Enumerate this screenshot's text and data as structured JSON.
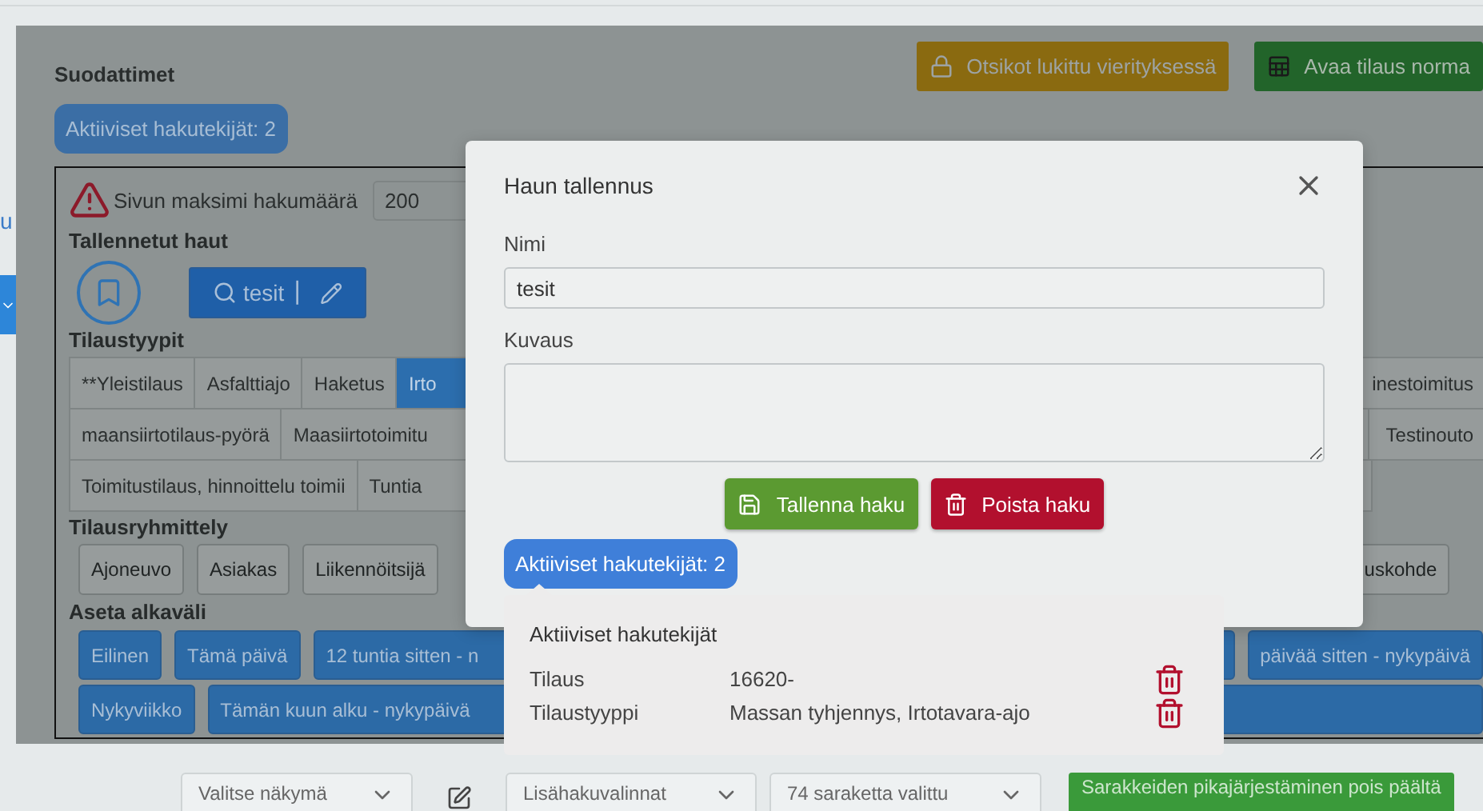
{
  "page": {
    "left_link": "u"
  },
  "header_buttons": [
    {
      "label": "Otsikot lukittu vierityksessä",
      "kind": "lock"
    },
    {
      "label": "Avaa tilaus norma",
      "kind": "table"
    }
  ],
  "filters": {
    "title": "Suodattimet",
    "active_badge": "Aktiiviset hakutekijät: 2",
    "max_label": "Sivun maksimi hakumäärä",
    "max_value": "200",
    "saved_title": "Tallennetut haut",
    "saved_search": "tesit",
    "saved_separator": "|",
    "order_types_title": "Tilaustyypit",
    "order_type_rows": [
      {
        "left": [
          {
            "label": "**Yleistilaus",
            "selected": false
          },
          {
            "label": "Asfalttiajo",
            "selected": false
          },
          {
            "label": "Haketus",
            "selected": false
          },
          {
            "label": "Irto",
            "selected": true
          }
        ],
        "right": [
          {
            "label": "inestoimitus",
            "selected": false
          }
        ]
      },
      {
        "left": [
          {
            "label": "maansiirtotilaus-pyörä",
            "selected": false
          },
          {
            "label": "Maasiirtotoimitu",
            "selected": false
          }
        ],
        "right": [
          {
            "label": "Testinouto",
            "selected": false
          }
        ]
      },
      {
        "left": [
          {
            "label": "Toimitustilaus, hinnoittelu toimii",
            "selected": false
          },
          {
            "label": "Tuntia",
            "selected": false
          }
        ],
        "right": []
      }
    ],
    "grouping_title": "Tilausryhmittely",
    "grouping": {
      "left": [
        "Ajoneuvo",
        "Asiakas",
        "Liikennöitsijä"
      ],
      "right": [
        "uskohde"
      ]
    },
    "range_title": "Aseta alkaväli",
    "range_rows": [
      {
        "left": [
          "Eilinen",
          "Tämä päivä",
          "12 tuntia sitten - n"
        ],
        "right": [
          "päivää sitten - nykypäivä"
        ]
      },
      {
        "left": [
          "Nykyviikko",
          "Tämän kuun alku - nykypäivä"
        ],
        "right": []
      }
    ]
  },
  "bottom_bar": {
    "view_select": "Valitse näkymä",
    "extra_select": "Lisähakuvalinnat",
    "columns_select": "74 saraketta valittu",
    "sort_button": "Sarakkeiden pikajärjestäminen pois päältä"
  },
  "modal": {
    "title": "Haun tallennus",
    "name_label": "Nimi",
    "name_value": "tesit",
    "description_label": "Kuvaus",
    "buttons": [
      {
        "label": "Tallenna haku",
        "kind": "save"
      },
      {
        "label": "Poista haku",
        "kind": "delete"
      }
    ],
    "active_badge": "Aktiiviset hakutekijät: 2"
  },
  "popover": {
    "title": "Aktiiviset hakutekijät",
    "rows": [
      {
        "label": "Tilaus",
        "value": "16620-"
      },
      {
        "label": "Tilaustyyppi",
        "value": "Massan tyhjennys, Irtotavara-ajo"
      }
    ]
  }
}
